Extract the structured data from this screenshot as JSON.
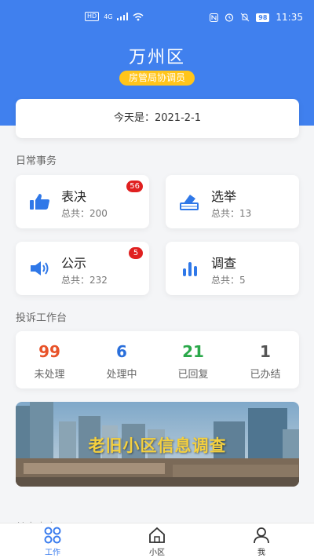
{
  "status_bar": {
    "network": "4G",
    "hd": "HD",
    "battery": "98",
    "time": "11:35"
  },
  "header": {
    "title": "万州区",
    "role_badge": "房管局协调员"
  },
  "date": {
    "text": "今天是：2021-2-1"
  },
  "daily": {
    "section_title": "日常事务",
    "items": [
      {
        "name": "表决",
        "total": "总共：200",
        "badge": "56",
        "icon": "thumbs-up-icon"
      },
      {
        "name": "选举",
        "total": "总共：13",
        "badge": "",
        "icon": "ballot-box-icon"
      },
      {
        "name": "公示",
        "total": "总共：232",
        "badge": "5",
        "icon": "speaker-icon"
      },
      {
        "name": "调查",
        "total": "总共：5",
        "badge": "",
        "icon": "bar-chart-icon"
      }
    ]
  },
  "complaints": {
    "section_title": "投诉工作台",
    "stats": [
      {
        "value": "99",
        "label": "未处理",
        "color": "#e8532a"
      },
      {
        "value": "6",
        "label": "处理中",
        "color": "#2a6fdb"
      },
      {
        "value": "21",
        "label": "已回复",
        "color": "#2aa84a"
      },
      {
        "value": "1",
        "label": "已办结",
        "color": "#555555"
      }
    ]
  },
  "banner": {
    "text": "老旧小区信息调查"
  },
  "other": {
    "section_title": "其它内容"
  },
  "tabbar": {
    "tabs": [
      {
        "label": "工作",
        "icon": "grid-icon",
        "active": true
      },
      {
        "label": "小区",
        "icon": "home-icon",
        "active": false
      },
      {
        "label": "我",
        "icon": "user-icon",
        "active": false
      }
    ]
  },
  "colors": {
    "primary": "#4080ee",
    "badge_yellow": "#ffc51a",
    "alert_red": "#e02020"
  }
}
